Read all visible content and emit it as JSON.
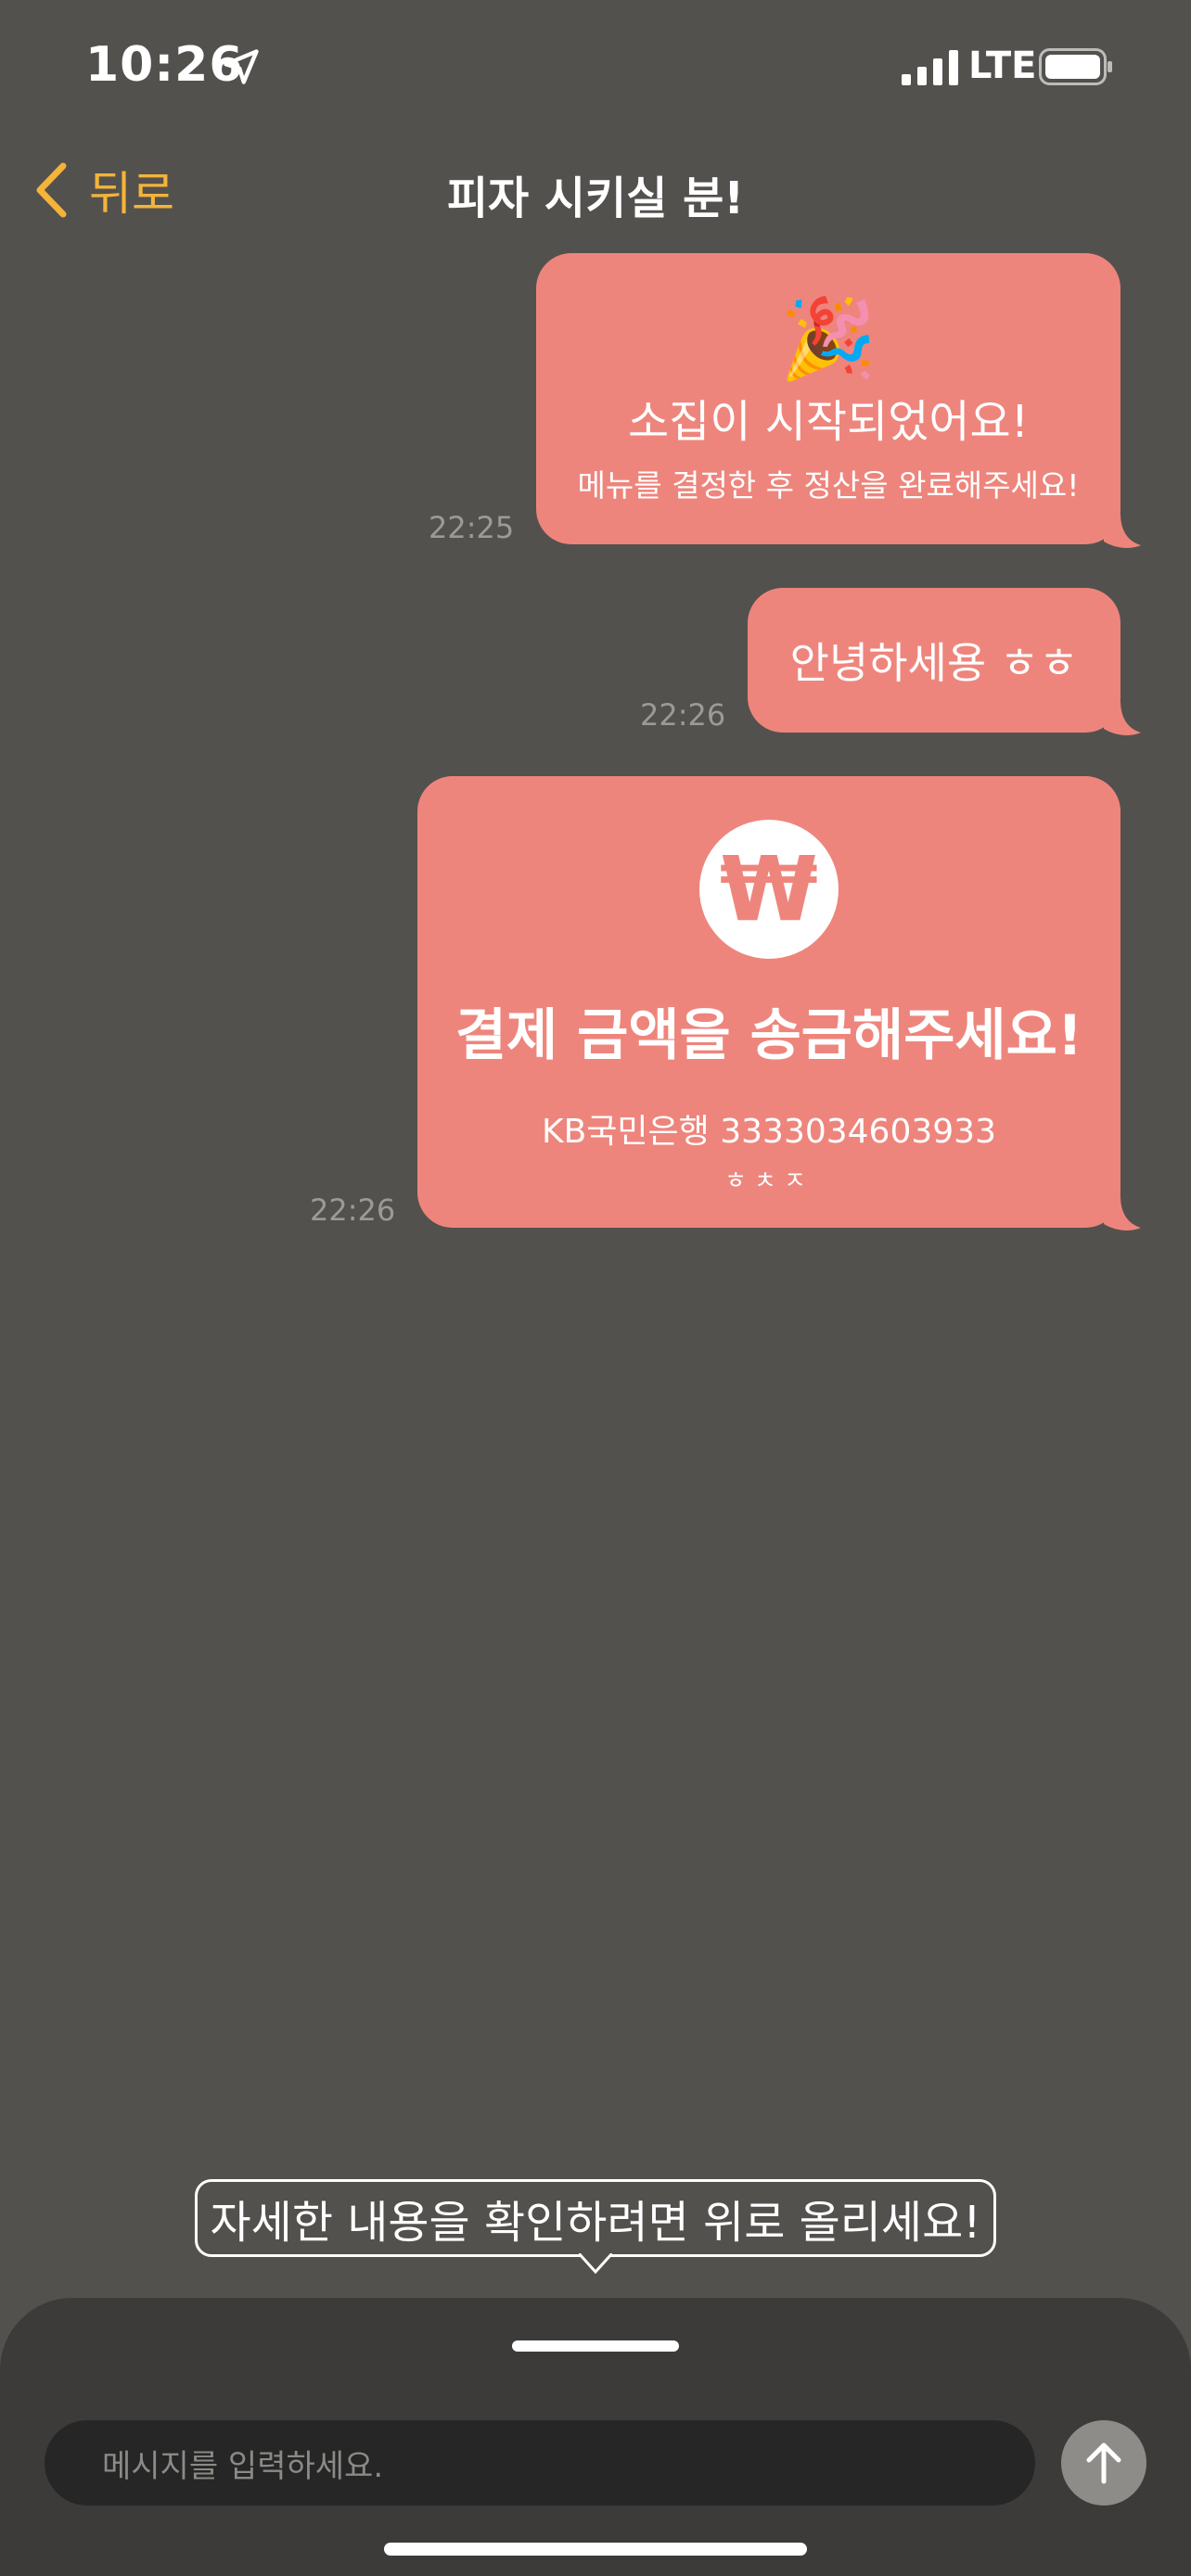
{
  "status_bar": {
    "time": "10:26",
    "network": "LTE",
    "icons": [
      "location-arrow-icon",
      "signal-icon",
      "battery-icon"
    ]
  },
  "nav": {
    "back_label": "뒤로",
    "title": "피자 시키실 분!",
    "accent_color": "#f4b43a"
  },
  "messages": [
    {
      "type": "system",
      "emoji": "🎉",
      "title": "소집이 시작되었어요!",
      "subtitle": "메뉴를 결정한 후 정산을 완료해주세요!",
      "time": "22:25"
    },
    {
      "type": "text",
      "text": "안녕하세용 ㅎㅎ",
      "time": "22:26"
    },
    {
      "type": "payment",
      "icon_symbol": "₩",
      "title": "결제 금액을 송금해주세요!",
      "account": "KB국민은행 3333034603933",
      "memo": "ㅎㅊㅈ",
      "time": "22:26"
    }
  ],
  "hint": {
    "text": "자세한 내용을 확인하려면 위로 올리세요!"
  },
  "composer": {
    "placeholder": "메시지를 입력하세요."
  },
  "colors": {
    "background": "#53514e",
    "bubble": "#ee857c",
    "sheet": "#3c3b39"
  }
}
